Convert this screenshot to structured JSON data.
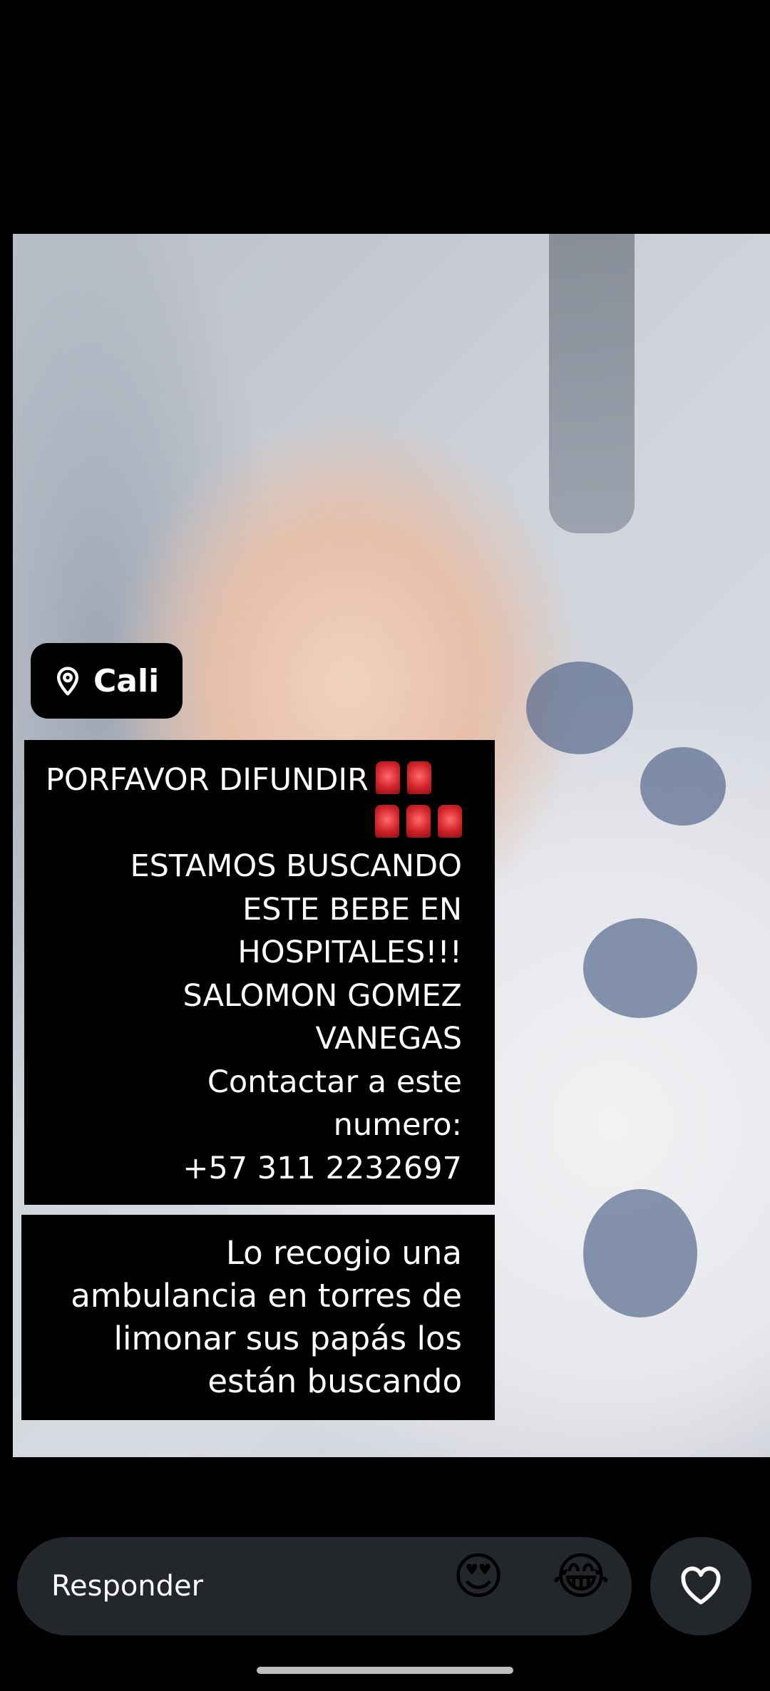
{
  "story": {
    "location": "Cali",
    "post_lines": [
      "PORFAVOR DIFUNDIR",
      "ESTAMOS BUSCANDO",
      "ESTE BEBE EN",
      "HOSPITALES!!!",
      "SALOMON GOMEZ",
      "VANEGAS",
      "Contactar a este",
      "numero:",
      "+57 311 2232697"
    ],
    "note_lines": [
      "Lo recogio  una",
      "ambulancia en torres de",
      "limonar sus papás los",
      "están buscando"
    ],
    "siren_emoji_count_line1": 2,
    "siren_emoji_count_line2": 3
  },
  "reply_bar": {
    "placeholder": "Responder",
    "quick_reactions": [
      "😍",
      "😂"
    ]
  },
  "icons": {
    "location": "map-pin-icon",
    "like": "heart-icon",
    "siren": "police-light-emoji"
  }
}
